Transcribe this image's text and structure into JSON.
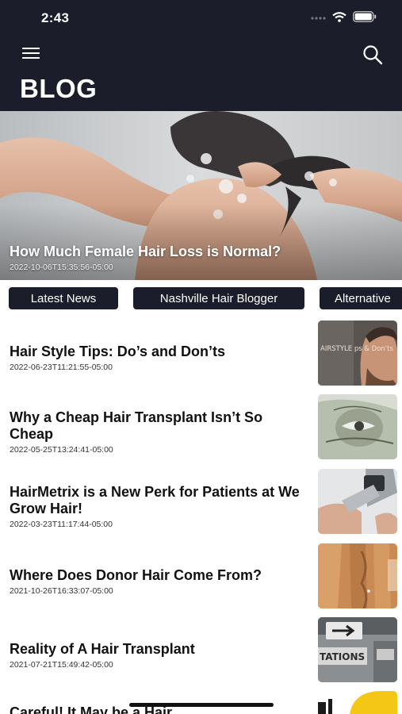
{
  "status_bar": {
    "time": "2:43"
  },
  "header": {
    "title": "BLOG"
  },
  "featured": {
    "title": "How Much Female Hair Loss is Normal?",
    "date": "2022-10-06T15:35:56-05:00"
  },
  "tabs": [
    {
      "label": "Latest News"
    },
    {
      "label": "Nashville Hair Blogger"
    },
    {
      "label": "Alternative"
    }
  ],
  "posts": [
    {
      "title": "Hair Style Tips: Do’s and Don’ts",
      "date": "2022-06-23T11:21:55-05:00",
      "thumb_text": "AIRSTYLE ps & Don'ts"
    },
    {
      "title": "Why a Cheap Hair Transplant Isn’t So Cheap",
      "date": "2022-05-25T13:24:41-05:00"
    },
    {
      "title": "HairMetrix is a New Perk for Patients at We Grow Hair!",
      "date": "2022-03-23T11:17:44-05:00"
    },
    {
      "title": "Where Does Donor Hair Come From?",
      "date": "2021-10-26T16:33:07-05:00"
    },
    {
      "title": "Reality of A Hair Transplant",
      "date": "2021-07-21T15:49:42-05:00",
      "thumb_text": "TATIONS"
    },
    {
      "title": "Careful! It May be a Hair..."
    }
  ],
  "colors": {
    "header_bg": "#1b1d2a",
    "tab_bg": "#1b1d2a",
    "accent_yellow": "#f4c716"
  },
  "icons": [
    "menu-icon",
    "search-icon",
    "signal-icon",
    "wifi-icon",
    "battery-icon"
  ]
}
